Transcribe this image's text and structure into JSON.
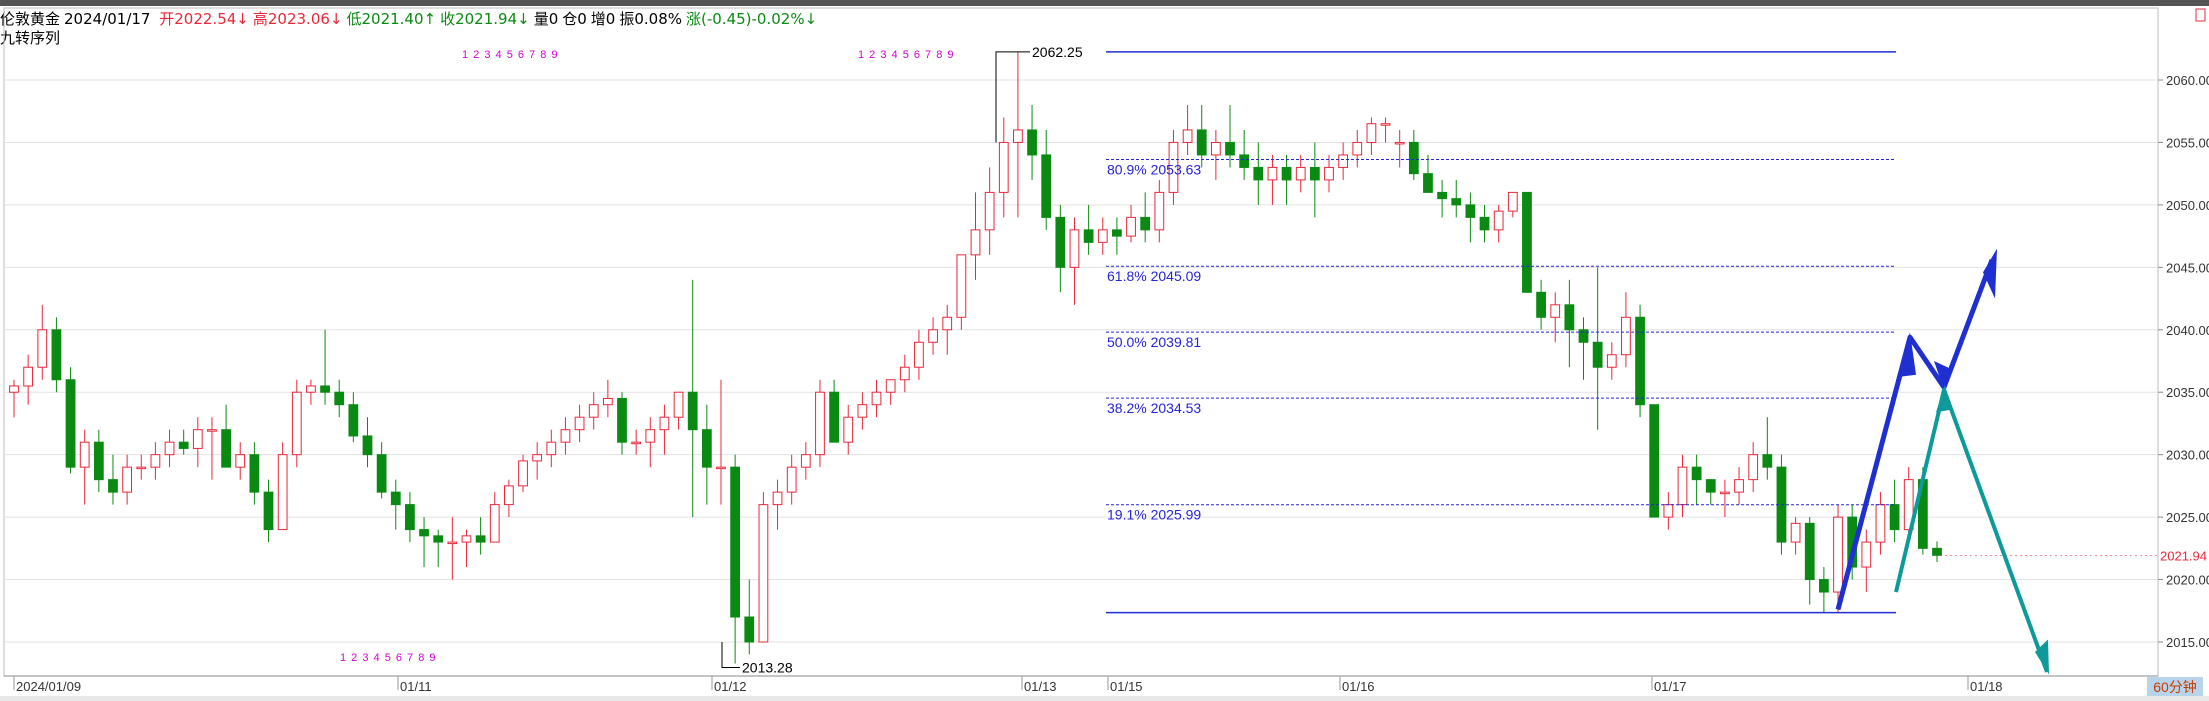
{
  "header": {
    "title": "伦敦黄金",
    "date": "2024/01/17",
    "open": "开2022.54↓",
    "high": "高2023.06↓",
    "low": "低2021.40↑",
    "close": "收2021.94↓",
    "volume": "量0",
    "position": "仓0",
    "increase": "增0",
    "amplitude": "振0.08%",
    "change": "涨(-0.45)-0.02%↓"
  },
  "indicator_label": "九转序列",
  "timeframe_label": "60分钟",
  "colors": {
    "up": "#e8283a",
    "down": "#0a8a12",
    "blue": "#1f2fd0",
    "teal": "#0e9a9a",
    "fib": "#2424d8",
    "grid": "#e2e2e2"
  },
  "chart_data": {
    "type": "candlestick",
    "y_axis": {
      "min": 2013,
      "max": 2064,
      "ticks": [
        2015.0,
        2020.0,
        2025.0,
        2030.0,
        2035.0,
        2040.0,
        2045.0,
        2050.0,
        2055.0,
        2060.0
      ]
    },
    "x_labels": [
      "2024/01/09",
      "01/11",
      "01/12",
      "01/13",
      "01/15",
      "01/16",
      "01/17",
      "01/18"
    ],
    "last_price": "2021.94",
    "fib_levels": [
      {
        "label": "80.9% 2053.63",
        "value": 2053.63
      },
      {
        "label": "61.8% 2045.09",
        "value": 2045.09
      },
      {
        "label": "50.0% 2039.81",
        "value": 2039.81
      },
      {
        "label": "38.2% 2034.53",
        "value": 2034.53
      },
      {
        "label": "19.1% 2025.99",
        "value": 2025.99
      }
    ],
    "range_lines": [
      2062.25,
      2017.35
    ],
    "annotations": [
      {
        "text": "2062.25",
        "value": 2062.25
      },
      {
        "text": "2013.28",
        "value": 2013.28
      }
    ],
    "nine_count": [
      {
        "text": "1 2 3 4 5 6 7 8 9"
      },
      {
        "text": "1 2 3 4 5 6 7 8 9"
      },
      {
        "text": "1 2 3 4 5 6 7 8 9"
      }
    ],
    "candles": [
      [
        2035,
        2036,
        2033,
        2035.5
      ],
      [
        2035.5,
        2038,
        2034,
        2037
      ],
      [
        2037,
        2042,
        2036,
        2040
      ],
      [
        2040,
        2041,
        2035,
        2036
      ],
      [
        2036,
        2037,
        2028.5,
        2029
      ],
      [
        2029,
        2032,
        2026,
        2031
      ],
      [
        2031,
        2032,
        2027,
        2028
      ],
      [
        2028,
        2030,
        2026,
        2027
      ],
      [
        2027,
        2030,
        2026,
        2029
      ],
      [
        2029,
        2030,
        2028,
        2029
      ],
      [
        2029,
        2031,
        2028,
        2030
      ],
      [
        2030,
        2032,
        2029,
        2031
      ],
      [
        2031,
        2032,
        2030,
        2030.5
      ],
      [
        2030.5,
        2033,
        2029,
        2032
      ],
      [
        2032,
        2033,
        2028,
        2032
      ],
      [
        2032,
        2034,
        2029,
        2029
      ],
      [
        2029,
        2031,
        2028,
        2030
      ],
      [
        2030,
        2031,
        2026,
        2027
      ],
      [
        2027,
        2028,
        2023,
        2024
      ],
      [
        2024,
        2031,
        2024,
        2030
      ],
      [
        2030,
        2036,
        2029,
        2035
      ],
      [
        2035,
        2036,
        2034,
        2035.5
      ],
      [
        2035.5,
        2040,
        2034,
        2035
      ],
      [
        2035,
        2036,
        2033,
        2034
      ],
      [
        2034,
        2035,
        2031,
        2031.5
      ],
      [
        2031.5,
        2033,
        2029,
        2030
      ],
      [
        2030,
        2031,
        2026.5,
        2027
      ],
      [
        2027,
        2028,
        2024,
        2026
      ],
      [
        2026,
        2027,
        2023,
        2024
      ],
      [
        2024,
        2025,
        2021,
        2023.5
      ],
      [
        2023.5,
        2024,
        2021,
        2023
      ],
      [
        2023,
        2025,
        2020,
        2023
      ],
      [
        2023,
        2024,
        2021,
        2023.5
      ],
      [
        2023.5,
        2025,
        2022,
        2023
      ],
      [
        2023,
        2027,
        2023,
        2026
      ],
      [
        2026,
        2028,
        2025,
        2027.5
      ],
      [
        2027.5,
        2030,
        2027,
        2029.5
      ],
      [
        2029.5,
        2031,
        2028,
        2030
      ],
      [
        2030,
        2032,
        2029,
        2031
      ],
      [
        2031,
        2033,
        2030,
        2032
      ],
      [
        2032,
        2034,
        2031,
        2033
      ],
      [
        2033,
        2035,
        2032,
        2034
      ],
      [
        2034,
        2036,
        2033,
        2034.5
      ],
      [
        2034.5,
        2035,
        2030,
        2031
      ],
      [
        2031,
        2032,
        2030,
        2031
      ],
      [
        2031,
        2033,
        2029,
        2032
      ],
      [
        2032,
        2034,
        2030,
        2033
      ],
      [
        2033,
        2035,
        2032,
        2035
      ],
      [
        2035,
        2044,
        2025,
        2032
      ],
      [
        2032,
        2034,
        2026,
        2029
      ],
      [
        2029,
        2036,
        2026,
        2029
      ],
      [
        2029,
        2030,
        2013.28,
        2017
      ],
      [
        2017,
        2020,
        2014,
        2015
      ],
      [
        2015,
        2027,
        2015,
        2026
      ],
      [
        2026,
        2028,
        2024,
        2027
      ],
      [
        2027,
        2030,
        2026,
        2029
      ],
      [
        2029,
        2031,
        2028,
        2030
      ],
      [
        2030,
        2036,
        2029,
        2035
      ],
      [
        2035,
        2036,
        2031,
        2031
      ],
      [
        2031,
        2034,
        2030,
        2033
      ],
      [
        2033,
        2035,
        2032,
        2034
      ],
      [
        2034,
        2036,
        2033,
        2035
      ],
      [
        2035,
        2036,
        2034,
        2036
      ],
      [
        2036,
        2038,
        2035,
        2037
      ],
      [
        2037,
        2040,
        2036,
        2039
      ],
      [
        2039,
        2041,
        2038,
        2040
      ],
      [
        2040,
        2042,
        2038,
        2041
      ],
      [
        2041,
        2046,
        2040,
        2046
      ],
      [
        2046,
        2051,
        2044,
        2048
      ],
      [
        2048,
        2053,
        2046,
        2051
      ],
      [
        2051,
        2057,
        2049,
        2055
      ],
      [
        2055,
        2062.25,
        2049,
        2056
      ],
      [
        2056,
        2058,
        2052,
        2054
      ],
      [
        2054,
        2056,
        2048,
        2049
      ],
      [
        2049,
        2050,
        2043,
        2045
      ],
      [
        2045,
        2049,
        2042,
        2048
      ],
      [
        2048,
        2050,
        2046,
        2047
      ],
      [
        2047,
        2049,
        2046,
        2048
      ],
      [
        2048,
        2049,
        2046,
        2047.5
      ],
      [
        2047.5,
        2050,
        2047,
        2049
      ],
      [
        2049,
        2051,
        2047,
        2048
      ],
      [
        2048,
        2052,
        2047,
        2051
      ],
      [
        2051,
        2056,
        2050,
        2055
      ],
      [
        2055,
        2058,
        2054,
        2056
      ],
      [
        2056,
        2058,
        2053,
        2054
      ],
      [
        2054,
        2056,
        2052,
        2055
      ],
      [
        2055,
        2058,
        2053,
        2054
      ],
      [
        2054,
        2056,
        2052,
        2053
      ],
      [
        2053,
        2055,
        2050,
        2052
      ],
      [
        2052,
        2054,
        2050,
        2053
      ],
      [
        2053,
        2054,
        2050,
        2052
      ],
      [
        2052,
        2054,
        2051,
        2053
      ],
      [
        2053,
        2055,
        2049,
        2052
      ],
      [
        2052,
        2054,
        2051,
        2053
      ],
      [
        2053,
        2055,
        2052,
        2054
      ],
      [
        2054,
        2056,
        2053,
        2055
      ],
      [
        2055,
        2057,
        2054,
        2056.5
      ],
      [
        2056.5,
        2057,
        2055,
        2056.5
      ],
      [
        2055,
        2056,
        2053,
        2055
      ],
      [
        2055,
        2056,
        2052,
        2052.5
      ],
      [
        2052.5,
        2054,
        2051,
        2051
      ],
      [
        2051,
        2052,
        2049,
        2050.5
      ],
      [
        2050.5,
        2052,
        2049,
        2050
      ],
      [
        2050,
        2051,
        2047,
        2049
      ],
      [
        2049,
        2050,
        2047,
        2048
      ],
      [
        2048,
        2050,
        2047,
        2049.5
      ],
      [
        2049.5,
        2051,
        2049,
        2051
      ],
      [
        2051,
        2051,
        2043,
        2043
      ],
      [
        2043,
        2044,
        2040,
        2041
      ],
      [
        2041,
        2043,
        2039,
        2042
      ],
      [
        2042,
        2044,
        2037,
        2040
      ],
      [
        2040,
        2041,
        2036,
        2039
      ],
      [
        2039,
        2045,
        2032,
        2037
      ],
      [
        2037,
        2039,
        2036,
        2038
      ],
      [
        2038,
        2043,
        2037,
        2041
      ],
      [
        2041,
        2042,
        2033,
        2034
      ],
      [
        2034,
        2034,
        2025,
        2025
      ],
      [
        2025,
        2027,
        2024,
        2026
      ],
      [
        2026,
        2030,
        2025,
        2029
      ],
      [
        2029,
        2030,
        2026,
        2028
      ],
      [
        2028,
        2028,
        2026,
        2027
      ],
      [
        2027,
        2028,
        2025,
        2027
      ],
      [
        2027,
        2029,
        2026,
        2028
      ],
      [
        2028,
        2031,
        2027,
        2030
      ],
      [
        2030,
        2033,
        2028,
        2029
      ],
      [
        2029,
        2030,
        2022,
        2023
      ],
      [
        2023,
        2025,
        2022,
        2024.5
      ],
      [
        2024.5,
        2025,
        2018,
        2020
      ],
      [
        2020,
        2021,
        2017.35,
        2019
      ],
      [
        2019,
        2026,
        2017.35,
        2025
      ],
      [
        2025,
        2026,
        2020,
        2021
      ],
      [
        2021,
        2024,
        2019,
        2023
      ],
      [
        2023,
        2027,
        2022,
        2026
      ],
      [
        2026,
        2028,
        2023,
        2024
      ],
      [
        2024,
        2029,
        2023,
        2028
      ],
      [
        2028,
        2029,
        2022,
        2022.5
      ],
      [
        2022.5,
        2023.06,
        2021.4,
        2021.94
      ]
    ]
  }
}
